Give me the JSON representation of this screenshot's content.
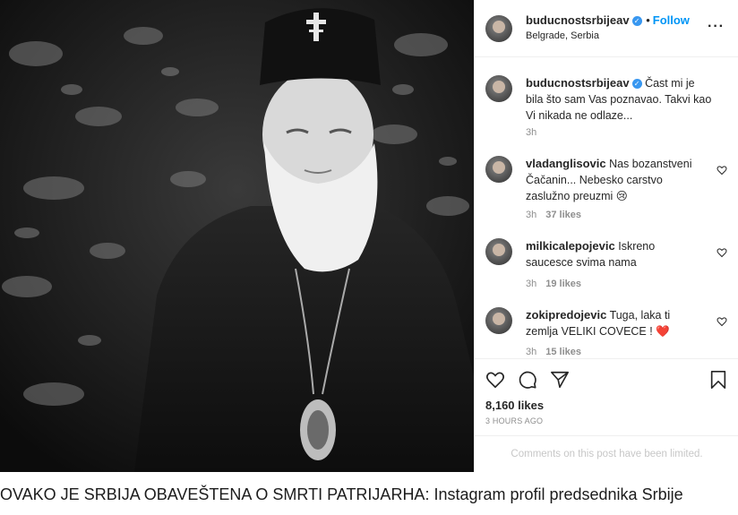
{
  "post": {
    "username": "buducnostsrbijeav",
    "verified_mark": "✓",
    "follow_separator": "•",
    "follow_label": "Follow",
    "location": "Belgrade, Serbia",
    "more_icon": "···",
    "likes": "8,160 likes",
    "time_ago": "3 HOURS AGO",
    "limited_notice": "Comments on this post have been limited."
  },
  "caption": {
    "username": "buducnostsrbijeav",
    "text": "Čast mi je bila što sam Vas poznavao. Takvi kao Vi nikada ne odlaze...",
    "time": "3h"
  },
  "comments": [
    {
      "username": "vladanglisovic",
      "text": "Nas bozanstveni Čačanin... Nebesko carstvo zaslužno preuzmi 😢",
      "time": "3h",
      "likes": "37 likes"
    },
    {
      "username": "milkicalepojevic",
      "text": "Iskreno saucesce svima nama",
      "time": "3h",
      "likes": "19 likes"
    },
    {
      "username": "zokipredojevic",
      "text": "Tuga, laka ti zemlja VELIKI COVECE ! ❤️",
      "time": "3h",
      "likes": "15 likes"
    }
  ],
  "icons": {
    "heart": "heart-icon",
    "comment": "comment-icon",
    "share": "share-icon",
    "save": "bookmark-icon",
    "comment_like": "heart-outline-icon"
  },
  "colors": {
    "follow_blue": "#0095f6",
    "verified_blue": "#3897f0",
    "muted": "#8e8e8e",
    "heart_red": "#ed4956"
  },
  "footer_caption": "OVAKO JE SRBIJA OBAVEŠTENA O SMRTI PATRIJARHA: Instagram profil predsednika Srbije"
}
